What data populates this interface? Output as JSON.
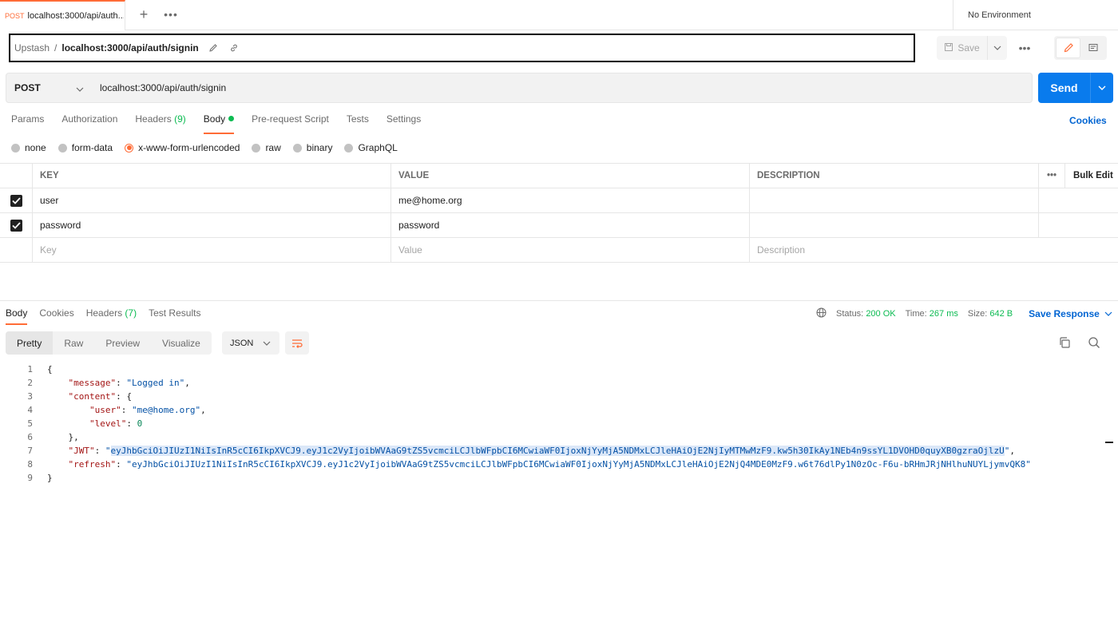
{
  "tab": {
    "method": "POST",
    "title": "localhost:3000/api/auth..."
  },
  "environment": "No Environment",
  "breadcrumb": {
    "parent": "Upstash",
    "separator": "/",
    "current": "localhost:3000/api/auth/signin"
  },
  "toolbar": {
    "save_label": "Save"
  },
  "request": {
    "method": "POST",
    "url": "localhost:3000/api/auth/signin",
    "send_label": "Send"
  },
  "request_tabs": [
    {
      "label": "Params"
    },
    {
      "label": "Authorization"
    },
    {
      "label": "Headers",
      "count": "(9)"
    },
    {
      "label": "Body"
    },
    {
      "label": "Pre-request Script"
    },
    {
      "label": "Tests"
    },
    {
      "label": "Settings"
    }
  ],
  "cookies_link": "Cookies",
  "body_types": [
    "none",
    "form-data",
    "x-www-form-urlencoded",
    "raw",
    "binary",
    "GraphQL"
  ],
  "selected_body_type": "x-www-form-urlencoded",
  "params_table": {
    "headers": {
      "key": "KEY",
      "value": "VALUE",
      "description": "DESCRIPTION",
      "bulk_edit": "Bulk Edit"
    },
    "rows": [
      {
        "checked": true,
        "key": "user",
        "value": "me@home.org"
      },
      {
        "checked": true,
        "key": "password",
        "value": "password"
      }
    ],
    "placeholders": {
      "key": "Key",
      "value": "Value",
      "description": "Description"
    }
  },
  "response_tabs": [
    {
      "label": "Body"
    },
    {
      "label": "Cookies"
    },
    {
      "label": "Headers",
      "count": "(7)"
    },
    {
      "label": "Test Results"
    }
  ],
  "response_meta": {
    "status_label": "Status:",
    "status_value": "200 OK",
    "time_label": "Time:",
    "time_value": "267 ms",
    "size_label": "Size:",
    "size_value": "642 B",
    "save_response": "Save Response"
  },
  "view_tabs": [
    "Pretty",
    "Raw",
    "Preview",
    "Visualize"
  ],
  "format": "JSON",
  "response_json": {
    "message": "Logged in",
    "user": "me@home.org",
    "level": "0",
    "jwt": "eyJhbGciOiJIUzI1NiIsInR5cCI6IkpXVCJ9.eyJ1c2VyIjoibWVAaG9tZS5vcmciLCJlbWFpbCI6MCwiaWF0IjoxNjYyMjA5NDMxLCJleHAiOjE2NjIyMTMwMzF9.kw5h30IkAy1NEb4n9ssYL1DVOHD0quyXB0gzraOjlzU",
    "refresh": "eyJhbGciOiJIUzI1NiIsInR5cCI6IkpXVCJ9.eyJ1c2VyIjoibWVAaG9tZS5vcmciLCJlbWFpbCI6MCwiaWF0IjoxNjYyMjA5NDMxLCJleHAiOjE2NjQ4MDE0MzF9.w6t76dlPy1N0zOc-F6u-bRHmJRjNHlhuNUYLjymvQK8"
  },
  "line_numbers": [
    "1",
    "2",
    "3",
    "4",
    "5",
    "6",
    "7",
    "8",
    "9"
  ],
  "colors": {
    "accent": "#ff6c37",
    "primary": "#097bed",
    "link": "#0265d2",
    "success": "#0cbb52"
  }
}
